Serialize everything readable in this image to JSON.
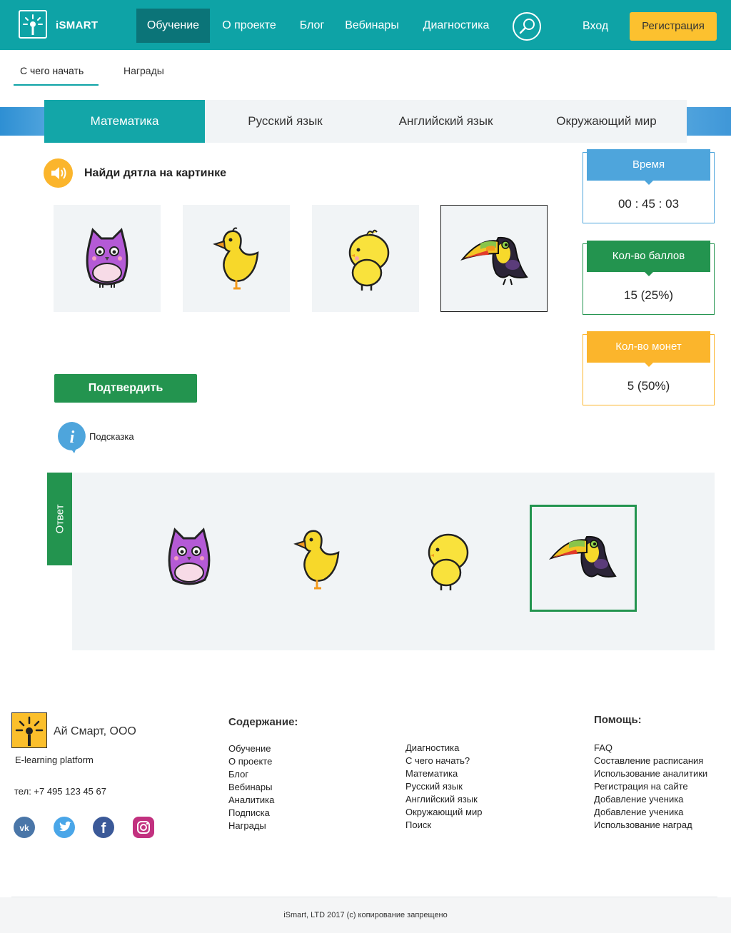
{
  "header": {
    "logo_text": "iSMART",
    "nav": [
      "Обучение",
      "О проекте",
      "Блог",
      "Вебинары",
      "Диагностика"
    ],
    "login": "Вход",
    "register": "Регистрация"
  },
  "subtabs": [
    "С чего начать",
    "Награды"
  ],
  "subjects": [
    "Математика",
    "Русский язык",
    "Английский язык",
    "Окружающий мир"
  ],
  "task": {
    "question": "Найди дятла на картинке",
    "options": [
      "owl-image",
      "duck-image",
      "chick-image",
      "toucan-image"
    ],
    "selected_index": 3,
    "confirm": "Подтвердить",
    "hint": "Подсказка"
  },
  "stats": {
    "time_label": "Время",
    "time_value": "00 : 45 : 03",
    "score_label": "Кол-во баллов",
    "score_value": "15 (25%)",
    "coins_label": "Кол-во монет",
    "coins_value": "5 (50%)"
  },
  "answer": {
    "tab_label": "Ответ",
    "correct_index": 3
  },
  "footer": {
    "company": "Ай Смарт, ООО",
    "tagline": "E-learning platform",
    "phone": "тел: +7 495 123 45 67",
    "social": [
      "vk-icon",
      "twitter-icon",
      "facebook-icon",
      "instagram-icon"
    ],
    "contents_title": "Содержание:",
    "contents_col1": [
      "Обучение",
      "О проекте",
      "Блог",
      "Вебинары",
      "Аналитика",
      "Подписка",
      "Награды"
    ],
    "contents_col2": [
      "Диагностика",
      "С чего начать?",
      "Математика",
      "Русский язык",
      "Английский язык",
      "Окружающий мир",
      "Поиск"
    ],
    "help_title": "Помощь:",
    "help_list": [
      "FAQ",
      "Составление расписания",
      "Использование аналитики",
      "Регистрация на сайте",
      "Добавление ученика",
      "Добавление ученика",
      "Использование наград"
    ],
    "copyright": "iSmart, LTD 2017 (c) копирование запрещено"
  },
  "colors": {
    "teal": "#0ea3a6",
    "teal_dark": "#0b7478",
    "green": "#23944f",
    "yellow": "#fbb52c",
    "blue": "#4ea5dc"
  }
}
